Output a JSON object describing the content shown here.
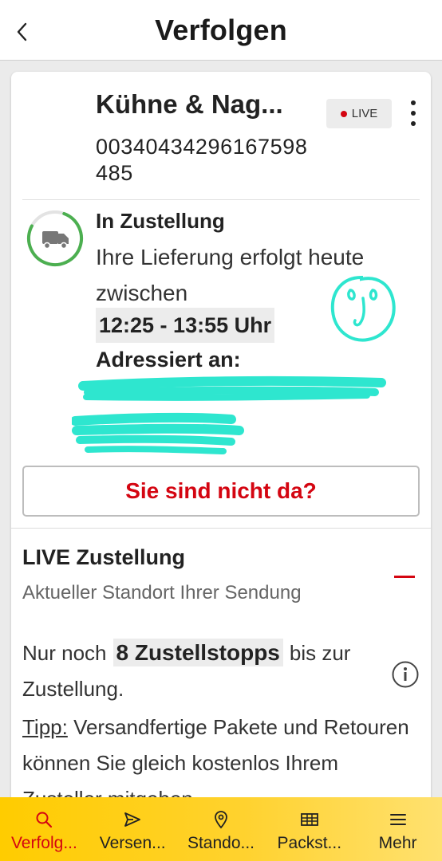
{
  "header": {
    "title": "Verfolgen",
    "back_icon": "chevron-left-icon"
  },
  "shipment": {
    "sender": "Kühne & Nag...",
    "tracking_number": "00340434296167598485",
    "live_badge": "LIVE",
    "menu_icon": "more-vertical-icon"
  },
  "status": {
    "icon": "delivery-van-icon",
    "title": "In Zustellung",
    "text": "Ihre Lieferung erfolgt heute zwischen",
    "time_window": "12:25 - 13:55 Uhr",
    "addressed_label": "Adressiert an:"
  },
  "not_home_button": "Sie sind nicht da?",
  "live_section": {
    "title": "LIVE Zustellung",
    "subtitle": "Aktueller Standort Ihrer Sendung",
    "collapse_icon": "minus-icon",
    "stops_prefix": "Nur noch",
    "stops_value": "8 Zustellstopps",
    "stops_suffix": "bis zur Zustellung.",
    "info_icon": "info-icon",
    "tip_label": "Tipp:",
    "tip_text": " Versandfertige Pakete und Retouren können Sie gleich kostenlos Ihrem Zusteller mitgeben."
  },
  "nav": {
    "items": [
      {
        "label": "Verfolg...",
        "icon": "search-icon",
        "active": true
      },
      {
        "label": "Versen...",
        "icon": "send-icon",
        "active": false
      },
      {
        "label": "Stando...",
        "icon": "location-pin-icon",
        "active": false
      },
      {
        "label": "Packst...",
        "icon": "packstation-icon",
        "active": false
      },
      {
        "label": "Mehr",
        "icon": "menu-icon",
        "active": false
      }
    ]
  },
  "colors": {
    "brand_yellow": "#ffcc00",
    "brand_red": "#d40511",
    "status_green": "#4caf50",
    "annotation_teal": "#2ee6cf"
  }
}
